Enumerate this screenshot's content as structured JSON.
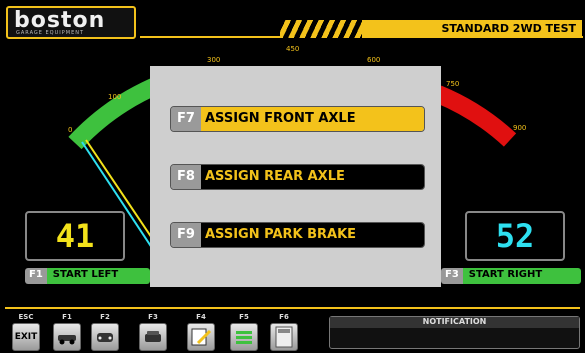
{
  "header": {
    "logo_text": "boston",
    "logo_subtext": "GARAGE EQUIPMENT",
    "title": "STANDARD 2WD TEST"
  },
  "gauge": {
    "tick_labels": [
      "0",
      "100",
      "300",
      "450",
      "600",
      "750",
      "900"
    ]
  },
  "left_value": "41",
  "right_value": "52",
  "colors": {
    "accent": "#f3c21b",
    "left_value": "#f3e21b",
    "right_value": "#2ee0f0",
    "green": "#3ec13e",
    "red": "#e01010"
  },
  "fkeys": {
    "left": {
      "key": "F1",
      "label": "START LEFT"
    },
    "right": {
      "key": "F3",
      "label": "START RIGHT"
    }
  },
  "modal": {
    "items": [
      {
        "key": "F7",
        "label": "ASSIGN FRONT AXLE",
        "active": true
      },
      {
        "key": "F8",
        "label": "ASSIGN REAR AXLE",
        "active": false
      },
      {
        "key": "F9",
        "label": "ASSIGN PARK BRAKE",
        "active": false
      }
    ]
  },
  "toolbar": {
    "buttons": [
      {
        "key": "ESC",
        "label": "EXIT",
        "icon": "exit-icon"
      },
      {
        "key": "F1",
        "label": "",
        "icon": "car-side-icon"
      },
      {
        "key": "F2",
        "label": "",
        "icon": "car-front-icon"
      },
      {
        "key": "F3",
        "label": "",
        "icon": "car-rear-icon"
      },
      {
        "key": "F4",
        "label": "",
        "icon": "edit-icon"
      },
      {
        "key": "F5",
        "label": "",
        "icon": "bars-icon"
      },
      {
        "key": "F6",
        "label": "",
        "icon": "calculator-icon"
      }
    ]
  },
  "notification": {
    "title": "NOTIFICATION",
    "text": ""
  }
}
